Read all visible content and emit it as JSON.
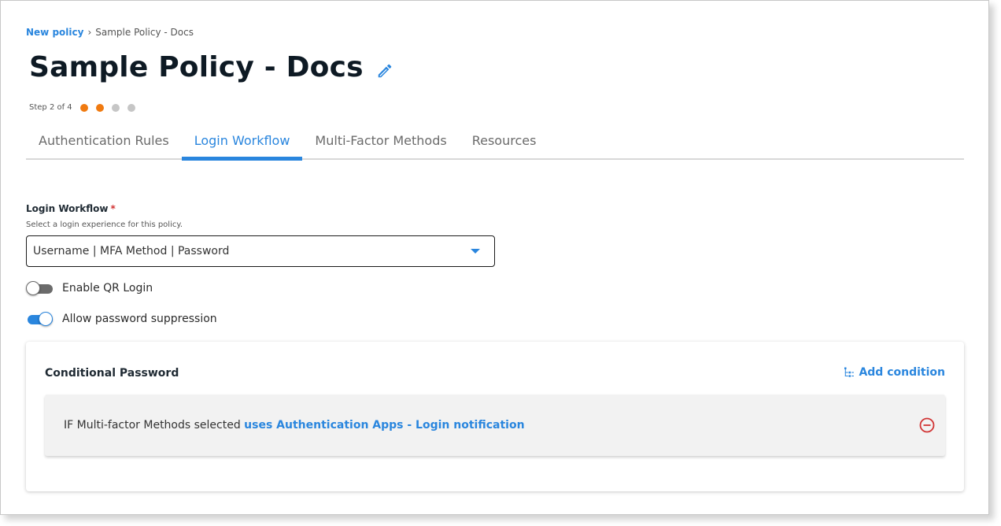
{
  "breadcrumb": {
    "parent": "New policy",
    "separator": "›",
    "current": "Sample Policy - Docs"
  },
  "page": {
    "title": "Sample Policy - Docs",
    "edit_icon": "pencil-icon"
  },
  "stepper": {
    "text": "Step 2 of 4",
    "total": 4,
    "current": 2,
    "active_color": "#f07a10",
    "inactive_color": "#c6c6c6"
  },
  "tabs": [
    {
      "label": "Authentication Rules",
      "active": false
    },
    {
      "label": "Login Workflow",
      "active": true
    },
    {
      "label": "Multi-Factor Methods",
      "active": false
    },
    {
      "label": "Resources",
      "active": false
    }
  ],
  "login_workflow": {
    "label": "Login Workflow",
    "required_mark": "*",
    "help": "Select a login experience for this policy.",
    "selected": "Username | MFA Method | Password"
  },
  "toggles": {
    "qr_login": {
      "label": "Enable QR Login",
      "enabled": false
    },
    "password_suppression": {
      "label": "Allow password suppression",
      "enabled": true
    }
  },
  "conditional_password": {
    "title": "Conditional Password",
    "add_label": "Add condition",
    "add_icon": "add-condition-icon",
    "condition": {
      "prefix": "IF Multi-factor Methods selected",
      "link": "uses Authentication Apps - Login notification",
      "remove_icon": "minus-circle-icon"
    }
  },
  "colors": {
    "accent": "#2a86de",
    "danger": "#d13434"
  }
}
